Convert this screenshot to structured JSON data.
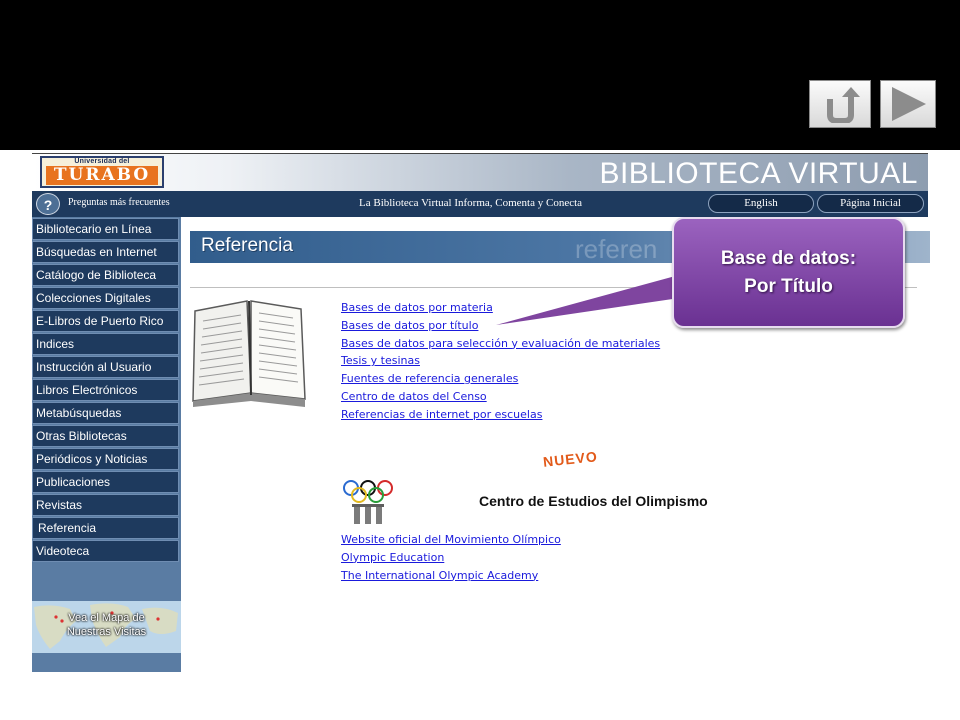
{
  "slide_nav": {
    "back_icon": "u-turn-back-arrow-icon",
    "next_icon": "play-next-triangle-icon"
  },
  "header": {
    "logo_small": "Universidad del",
    "logo_main": "TURABO",
    "title": "BIBLIOTECA VIRTUAL"
  },
  "navbar": {
    "help_icon": "?",
    "faq": "Preguntas más frecuentes",
    "tagline": "La Biblioteca Virtual Informa, Comenta y Conecta",
    "english": "English",
    "home": "Página Inicial"
  },
  "sidebar": {
    "items": [
      "Bibliotecario en Línea",
      "Búsquedas en Internet",
      "Catálogo de Biblioteca",
      "Colecciones Digitales",
      "E-Libros de Puerto Rico",
      "Indices",
      "Instrucción al Usuario",
      "Libros Electrónicos",
      "Metabúsquedas",
      "Otras Bibliotecas",
      "Periódicos y Noticias",
      "Publicaciones",
      "Revistas",
      "Referencia",
      "Videoteca"
    ],
    "map_caption_1": "Vea el Mapa de",
    "map_caption_2": "Nuestras Visitas"
  },
  "main": {
    "banner_title": "Referencia",
    "banner_watermark": "referen",
    "reference_links": [
      "Bases de datos por materia",
      "Bases de datos por título",
      "Bases de datos para selección y evaluación de materiales",
      "Tesis y tesinas",
      "Fuentes de referencia generales",
      "Centro de datos del Censo",
      "Referencias de internet por escuelas"
    ],
    "nuevo": "NUEVO",
    "olympic_title": "Centro de Estudios del Olimpismo",
    "olympic_links": [
      "Website oficial del Movimiento Olímpico",
      "Olympic Education",
      "The International Olympic Academy"
    ]
  },
  "callout": {
    "line1": "Base de datos:",
    "line2": "Por Título"
  },
  "colors": {
    "nav_dark": "#1e3a5e",
    "link_blue": "#1a1adc",
    "callout_purple": "#7a3fa3",
    "nuevo_orange": "#e25a1a"
  }
}
